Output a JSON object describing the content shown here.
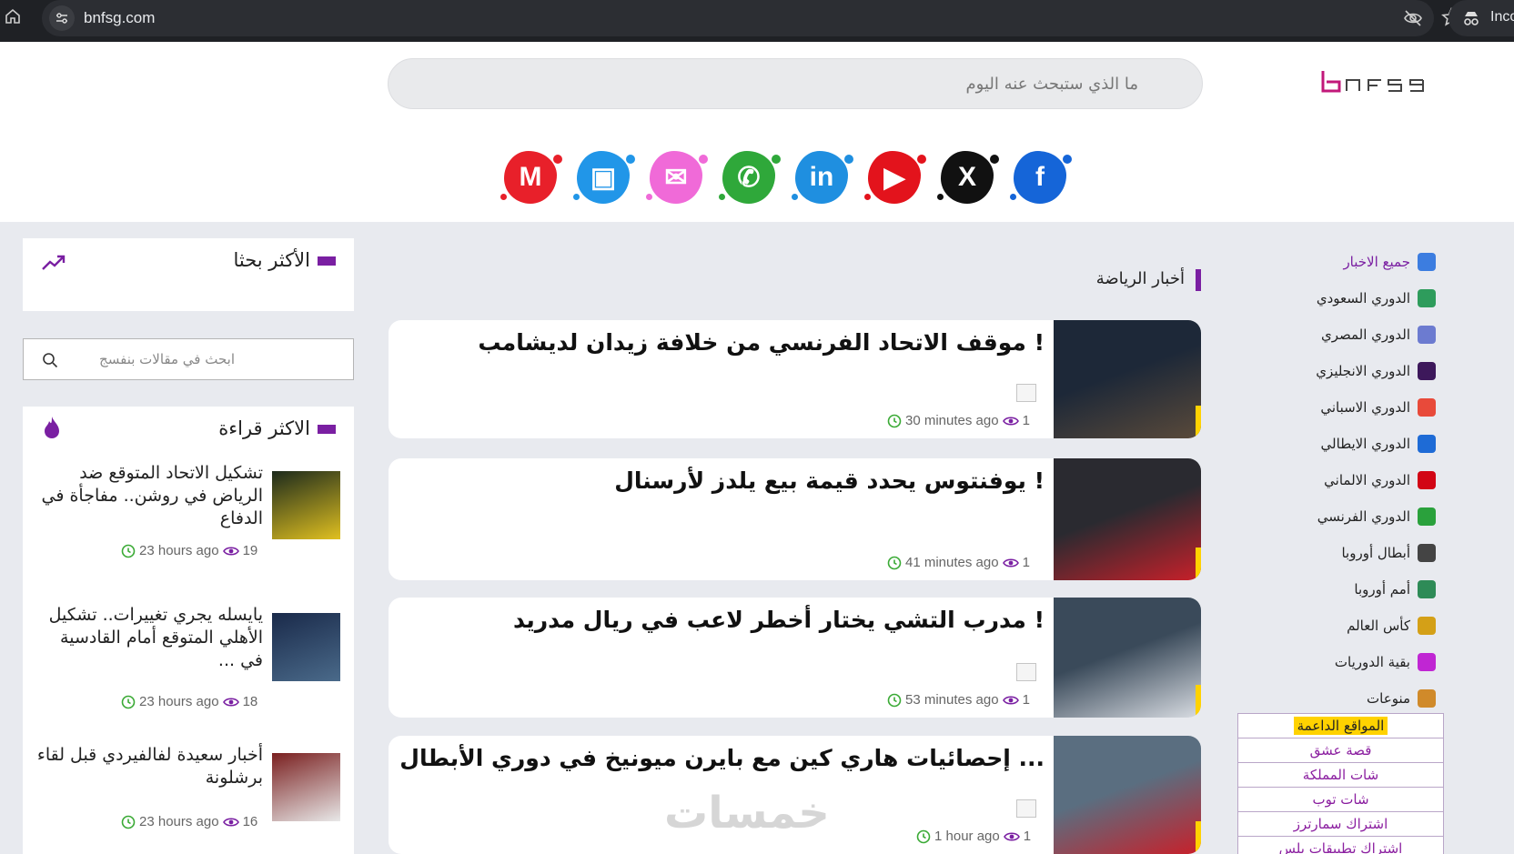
{
  "browser": {
    "url": "bnfsg.com",
    "incognito_label": "Inco"
  },
  "header": {
    "logo_text": "bnfsg",
    "search_placeholder": "ما الذي ستبحث عنه اليوم",
    "social": [
      {
        "name": "facebook-icon",
        "color": "#1565d8",
        "glyph": "f"
      },
      {
        "name": "x-icon",
        "color": "#111111",
        "glyph": "X"
      },
      {
        "name": "youtube-icon",
        "color": "#e3131c",
        "glyph": "▶"
      },
      {
        "name": "linkedin-icon",
        "color": "#1f8fe0",
        "glyph": "in"
      },
      {
        "name": "whatsapp-icon",
        "color": "#2fa83a",
        "glyph": "✆"
      },
      {
        "name": "email-icon",
        "color": "#f06ad8",
        "glyph": "✉"
      },
      {
        "name": "outlook-icon",
        "color": "#2196e8",
        "glyph": "▣"
      },
      {
        "name": "gmail-icon",
        "color": "#e8202a",
        "glyph": "M"
      }
    ]
  },
  "nav": {
    "items": [
      {
        "label": "جميع الاخبار",
        "icon": "news-icon",
        "color": "#3c7de0"
      },
      {
        "label": "الدوري السعودي",
        "icon": "saudi-league-icon",
        "color": "#2e9c5c"
      },
      {
        "label": "الدوري المصري",
        "icon": "egyptian-league-icon",
        "color": "#6c7bd0"
      },
      {
        "label": "الدوري الانجليزي",
        "icon": "premier-league-icon",
        "color": "#3d185b"
      },
      {
        "label": "الدوري الاسباني",
        "icon": "laliga-icon",
        "color": "#e84a3a"
      },
      {
        "label": "الدوري الايطالي",
        "icon": "serie-a-icon",
        "color": "#1e6bd6"
      },
      {
        "label": "الدوري الالماني",
        "icon": "bundesliga-icon",
        "color": "#d20515"
      },
      {
        "label": "الدوري الفرنسي",
        "icon": "ligue1-icon",
        "color": "#2aa13c"
      },
      {
        "label": "أبطال أوروبا",
        "icon": "champions-league-icon",
        "color": "#444444"
      },
      {
        "label": "أمم أوروبا",
        "icon": "euro-icon",
        "color": "#2e8b57"
      },
      {
        "label": "كأس العالم",
        "icon": "world-cup-icon",
        "color": "#d4a017"
      },
      {
        "label": "بقية الدوريات",
        "icon": "more-leagues-icon",
        "color": "#c026d3"
      },
      {
        "label": "منوعات",
        "icon": "misc-icon",
        "color": "#d08a2a"
      }
    ]
  },
  "support": {
    "title": "المواقع الداعمة",
    "links": [
      "قصة عشق",
      "شات المملكة",
      "شات توب",
      "اشتراك سمارترز",
      "اشتراك تطبيقات بلس"
    ]
  },
  "main": {
    "section_title": "أخبار الرياضة",
    "watermark": "خمسات",
    "articles": [
      {
        "title": "! موقف الاتحاد الفرنسي من خلافة زيدان لديشامب",
        "time": "30 minutes ago",
        "views": "1",
        "thumb_colors": [
          "#1d2838",
          "#5a4a3a"
        ]
      },
      {
        "title": "! يوفنتوس يحدد قيمة بيع يلدز لأرسنال",
        "time": "41 minutes ago",
        "views": "1",
        "source_logo": "kora",
        "thumb_colors": [
          "#2a2a30",
          "#c8202a"
        ]
      },
      {
        "title": "! مدرب التشي يختار أخطر لاعب في ريال مدريد",
        "time": "53 minutes ago",
        "views": "1",
        "thumb_colors": [
          "#3a4a5a",
          "#d8dce2"
        ]
      },
      {
        "title": "... إحصائيات هاري كين مع بايرن ميونيخ في دوري الأبطال",
        "time": "1 hour ago",
        "views": "1",
        "thumb_colors": [
          "#5a6e80",
          "#c8202a"
        ]
      }
    ]
  },
  "sidebar": {
    "most_searched_title": "الأكثر بحثا",
    "search_placeholder": "ابحث في مقالات بنفسج",
    "most_read_title": "الاكثر قراءة",
    "most_read": [
      {
        "title": "تشكيل الاتحاد المتوقع ضد الرياض في روشن.. مفاجأة في الدفاع",
        "time": "23 hours ago",
        "views": "19",
        "thumb_colors": [
          "#1c2a1c",
          "#e0c020"
        ]
      },
      {
        "title": "يايسله يجري تغييرات.. تشكيل الأهلي المتوقع أمام القادسية في ...",
        "time": "23 hours ago",
        "views": "18",
        "thumb_colors": [
          "#1a2a4a",
          "#4a6a8a"
        ]
      },
      {
        "title": "أخبار سعيدة لفالفيردي قبل لقاء برشلونة",
        "time": "23 hours ago",
        "views": "16",
        "thumb_colors": [
          "#7a2020",
          "#e8e8e8"
        ]
      }
    ]
  },
  "colors": {
    "accent": "#7a1fa2",
    "highlight": "#ffd200",
    "time_icon": "#3aaa35"
  }
}
